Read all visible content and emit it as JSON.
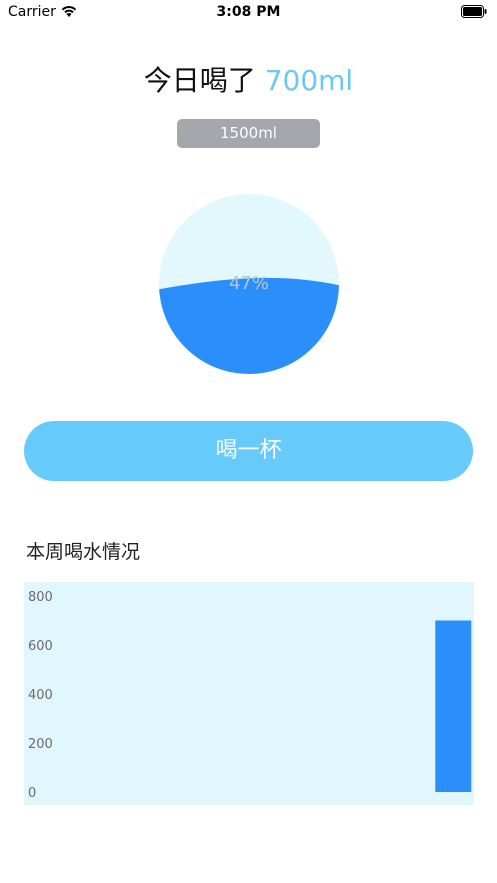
{
  "status_bar": {
    "carrier": "Carrier",
    "time": "3:08 PM"
  },
  "header": {
    "title_prefix": "今日喝了",
    "amount": "700ml"
  },
  "goal": {
    "label": "1500ml"
  },
  "gauge": {
    "percent_label": "47%",
    "fill_fraction": 0.47,
    "fill_color": "#2a8ffb",
    "empty_color": "#e3f8fd"
  },
  "action": {
    "drink_label": "喝一杯"
  },
  "weekly": {
    "title": "本周喝水情况"
  },
  "chart_data": {
    "type": "bar",
    "categories": [
      "",
      "",
      "",
      "",
      "",
      "",
      ""
    ],
    "values": [
      0,
      0,
      0,
      0,
      0,
      0,
      700
    ],
    "ylim": [
      0,
      800
    ],
    "yticks": [
      "0",
      "200",
      "400",
      "600",
      "800"
    ],
    "bar_color": "#2a8ffb",
    "background": "#e2f7fd",
    "grid": false
  },
  "colors": {
    "accent": "#6cc8f4",
    "button": "#66cbfb",
    "badge": "#a6a6ad"
  }
}
